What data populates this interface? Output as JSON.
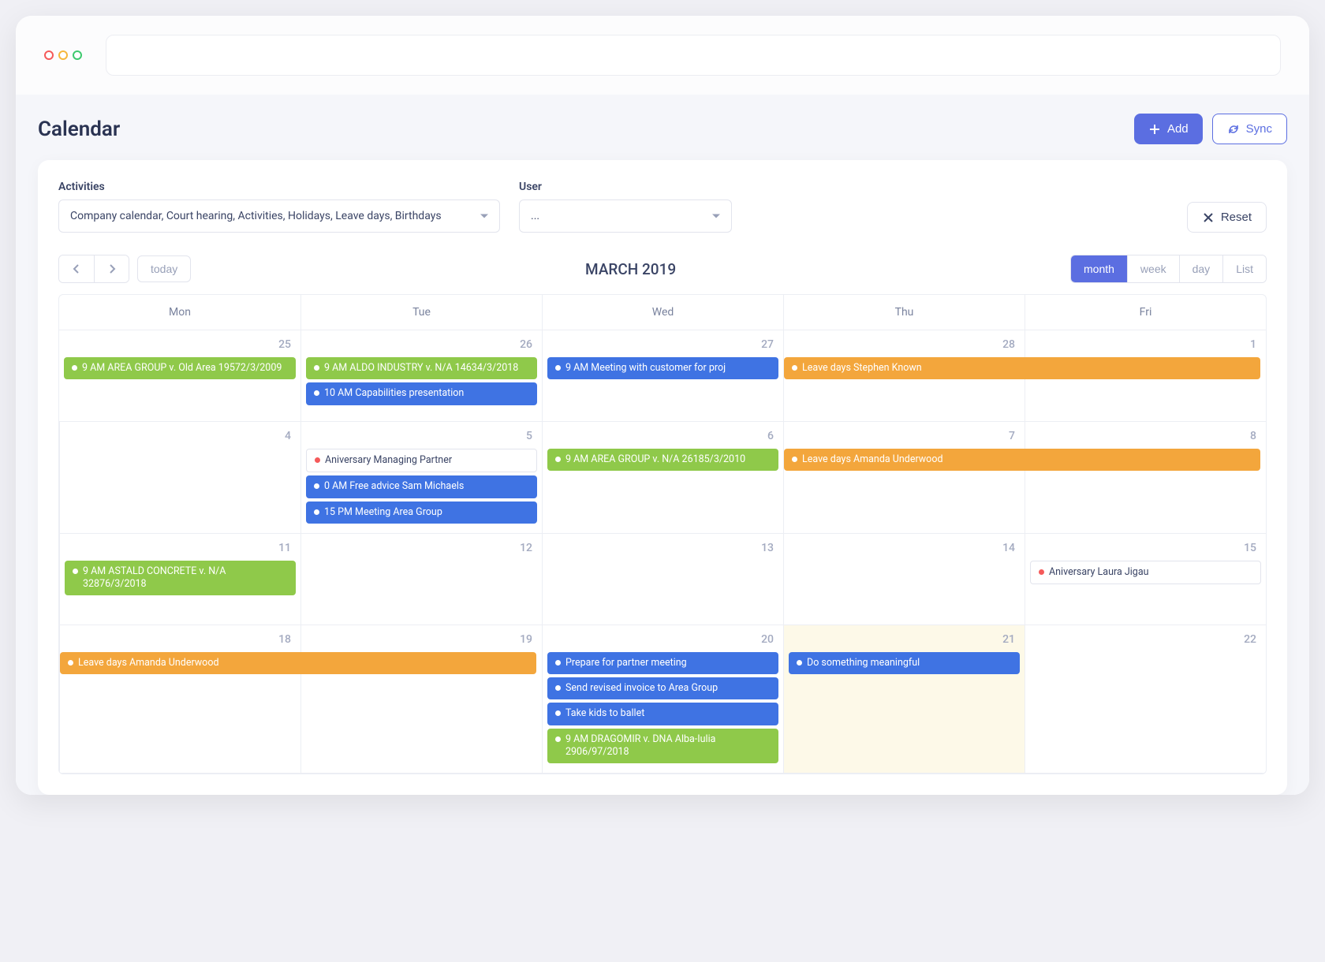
{
  "page": {
    "title": "Calendar"
  },
  "actions": {
    "add": "Add",
    "sync": "Sync",
    "reset": "Reset"
  },
  "filters": {
    "activities_label": "Activities",
    "activities_value": "Company calendar, Court hearing, Activities, Holidays, Leave days, Birthdays",
    "user_label": "User",
    "user_value": "..."
  },
  "calendar": {
    "title": "MARCH 2019",
    "today_label": "today",
    "views": {
      "month": "month",
      "week": "week",
      "day": "day",
      "list": "List"
    },
    "active_view": "month",
    "day_headers": [
      "Mon",
      "Tue",
      "Wed",
      "Thu",
      "Fri"
    ],
    "cells": [
      {
        "num": "25",
        "events": [
          {
            "color": "green",
            "text": "9 AM AREA GROUP v. Old Area 19572/3/2009",
            "wrap": true
          }
        ]
      },
      {
        "num": "26",
        "events": [
          {
            "color": "green",
            "text": "9 AM ALDO INDUSTRY v. N/A 14634/3/2018",
            "wrap": true
          },
          {
            "color": "blue",
            "text": "10 AM Capabilities presentation"
          }
        ]
      },
      {
        "num": "27",
        "events": [
          {
            "color": "blue",
            "text": "9 AM Meeting with customer for proj",
            "trunc": true
          }
        ]
      },
      {
        "num": "28",
        "events": [],
        "span_start": {
          "color": "orange",
          "text": "Leave days Stephen Known",
          "span": 2
        }
      },
      {
        "num": "1",
        "events": []
      },
      {
        "num": "4",
        "events": []
      },
      {
        "num": "5",
        "events": [
          {
            "color": "white",
            "text": "Aniversary Managing Partner"
          },
          {
            "color": "blue",
            "text": "0 AM Free advice Sam Michaels"
          },
          {
            "color": "blue",
            "text": "15 PM Meeting Area Group"
          }
        ]
      },
      {
        "num": "6",
        "events": [
          {
            "color": "green",
            "text": "9 AM AREA GROUP v. N/A 26185/3/2010",
            "wrap": true
          }
        ]
      },
      {
        "num": "7",
        "events": [],
        "span_start": {
          "color": "orange",
          "text": "Leave days Amanda Underwood",
          "span": 2
        }
      },
      {
        "num": "8",
        "events": []
      },
      {
        "num": "11",
        "events": [
          {
            "color": "green",
            "text": "9 AM ASTALD CONCRETE v. N/A 32876/3/2018",
            "wrap": true
          }
        ]
      },
      {
        "num": "12",
        "events": []
      },
      {
        "num": "13",
        "events": []
      },
      {
        "num": "14",
        "events": []
      },
      {
        "num": "15",
        "events": [
          {
            "color": "white",
            "text": "Aniversary Laura Jigau"
          }
        ]
      },
      {
        "num": "18",
        "events": [],
        "span_start": {
          "color": "orange",
          "text": "Leave days Amanda Underwood",
          "span": 2
        }
      },
      {
        "num": "19",
        "events": []
      },
      {
        "num": "20",
        "events": [
          {
            "color": "blue",
            "text": "Prepare for partner meeting"
          },
          {
            "color": "blue",
            "text": "Send revised invoice to Area Group"
          },
          {
            "color": "blue",
            "text": "Take kids to ballet"
          },
          {
            "color": "green",
            "text": "9 AM DRAGOMIR v. DNA Alba-Iulia 2906/97/2018",
            "wrap": true
          }
        ]
      },
      {
        "num": "21",
        "today": true,
        "events": [
          {
            "color": "blue",
            "text": "Do something meaningful"
          }
        ]
      },
      {
        "num": "22",
        "events": []
      }
    ]
  }
}
